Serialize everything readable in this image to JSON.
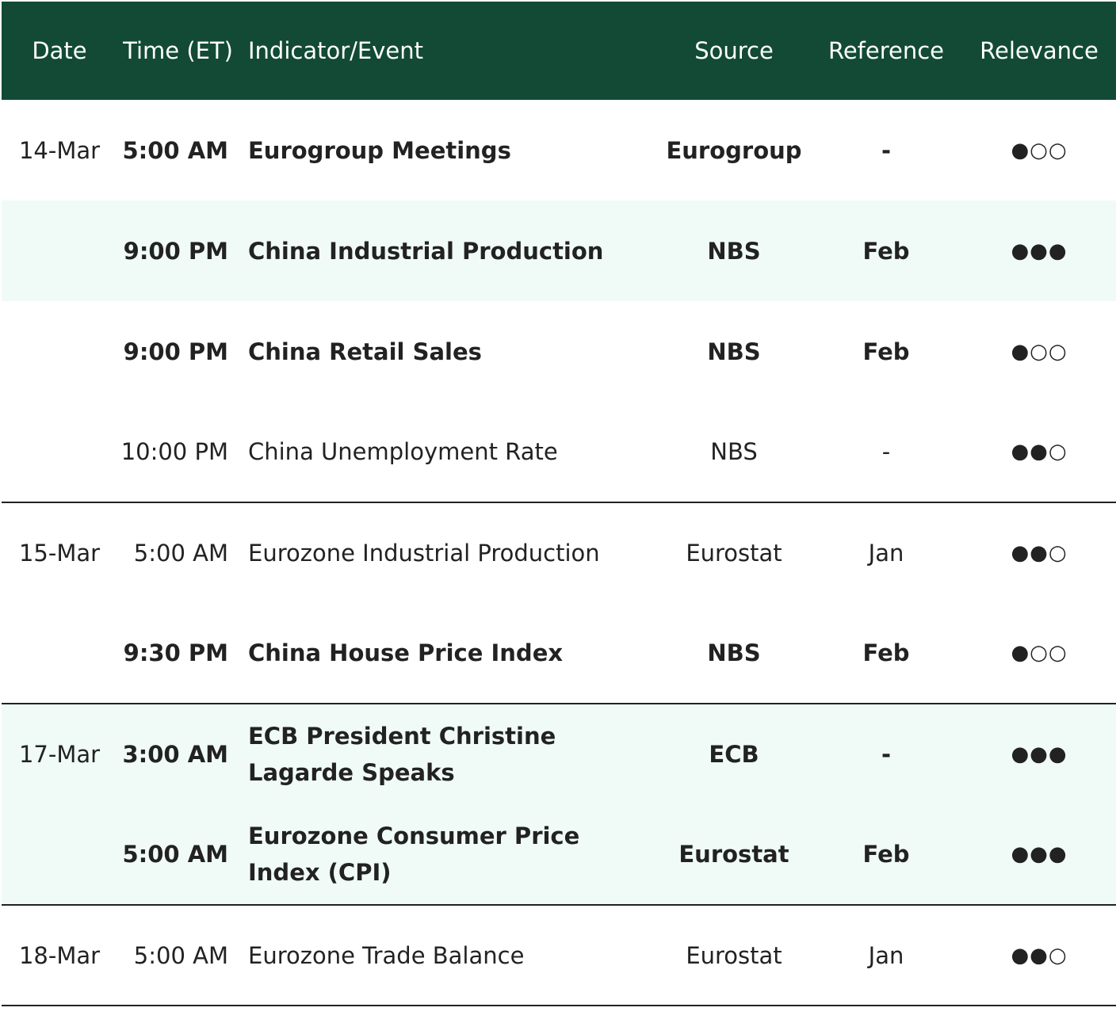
{
  "header": {
    "date": "Date",
    "time": "Time (ET)",
    "event": "Indicator/Event",
    "source": "Source",
    "reference": "Reference",
    "relevance": "Relevance"
  },
  "rows": [
    {
      "date": "14-Mar",
      "time": "5:00 AM",
      "event": "Eurogroup Meetings",
      "source": "Eurogroup",
      "reference": "-",
      "relevance": "●○○"
    },
    {
      "date": "",
      "time": "9:00 PM",
      "event": "China Industrial Production",
      "source": "NBS",
      "reference": "Feb",
      "relevance": "●●●"
    },
    {
      "date": "",
      "time": "9:00 PM",
      "event": "China Retail Sales",
      "source": "NBS",
      "reference": "Feb",
      "relevance": "●○○"
    },
    {
      "date": "",
      "time": "10:00 PM",
      "event": "China Unemployment Rate",
      "source": "NBS",
      "reference": "-",
      "relevance": "●●○"
    },
    {
      "date": "15-Mar",
      "time": "5:00 AM",
      "event": "Eurozone Industrial Production",
      "source": "Eurostat",
      "reference": "Jan",
      "relevance": "●●○"
    },
    {
      "date": "",
      "time": "9:30 PM",
      "event": "China House Price Index",
      "source": "NBS",
      "reference": "Feb",
      "relevance": "●○○"
    },
    {
      "date": "17-Mar",
      "time": "3:00 AM",
      "event": "ECB President Christine Lagarde Speaks",
      "source": "ECB",
      "reference": "-",
      "relevance": "●●●"
    },
    {
      "date": "",
      "time": "5:00 AM",
      "event": "Eurozone Consumer Price Index (CPI)",
      "source": "Eurostat",
      "reference": "Feb",
      "relevance": "●●●"
    },
    {
      "date": "18-Mar",
      "time": "5:00 AM",
      "event": "Eurozone Trade Balance",
      "source": "Eurostat",
      "reference": "Jan",
      "relevance": "●●○"
    }
  ],
  "colors": {
    "header_bg": "#124a36",
    "shaded_row": "#f0fbf7",
    "text": "#222222"
  }
}
